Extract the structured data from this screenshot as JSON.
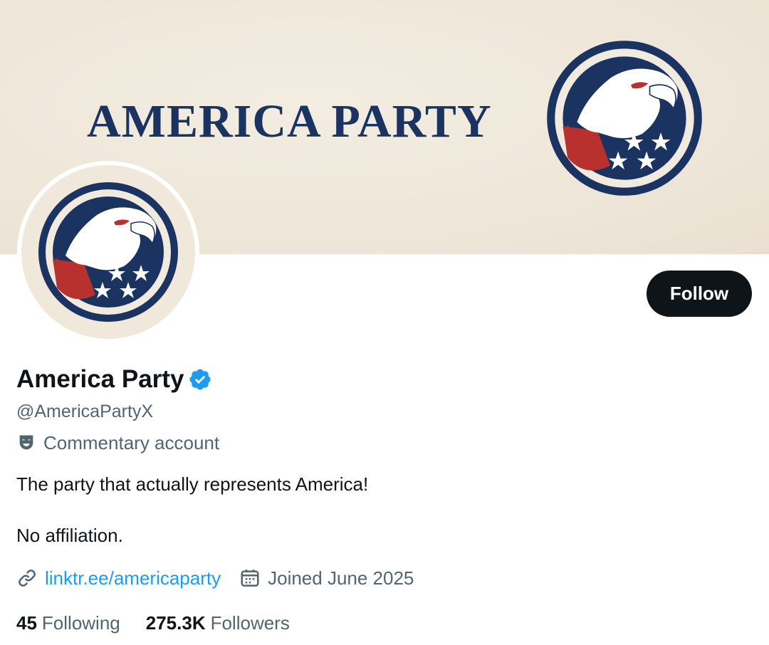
{
  "banner": {
    "title": "AMERICA PARTY",
    "emblem_icon": "eagle-emblem"
  },
  "profile": {
    "avatar_icon": "eagle-emblem",
    "display_name": "America Party",
    "verified_icon": "verified-badge-icon",
    "handle": "@AmericaPartyX",
    "label": "Commentary account",
    "label_icon": "parody-mask-icon",
    "bio_line1": "The party that actually represents America!",
    "bio_line2": "No affiliation.",
    "link": "linktr.ee/americaparty",
    "link_icon": "link-icon",
    "joined": "Joined June 2025",
    "joined_icon": "calendar-icon"
  },
  "stats": {
    "following_count": "45",
    "following_label": "Following",
    "followers_count": "275.3K",
    "followers_label": "Followers"
  },
  "actions": {
    "follow_label": "Follow"
  },
  "colors": {
    "navy": "#1b3360",
    "red": "#b8312f",
    "banner_bg": "#efe8db",
    "link_blue": "#1d9bf0",
    "muted": "#536471",
    "text": "#0f1419"
  }
}
